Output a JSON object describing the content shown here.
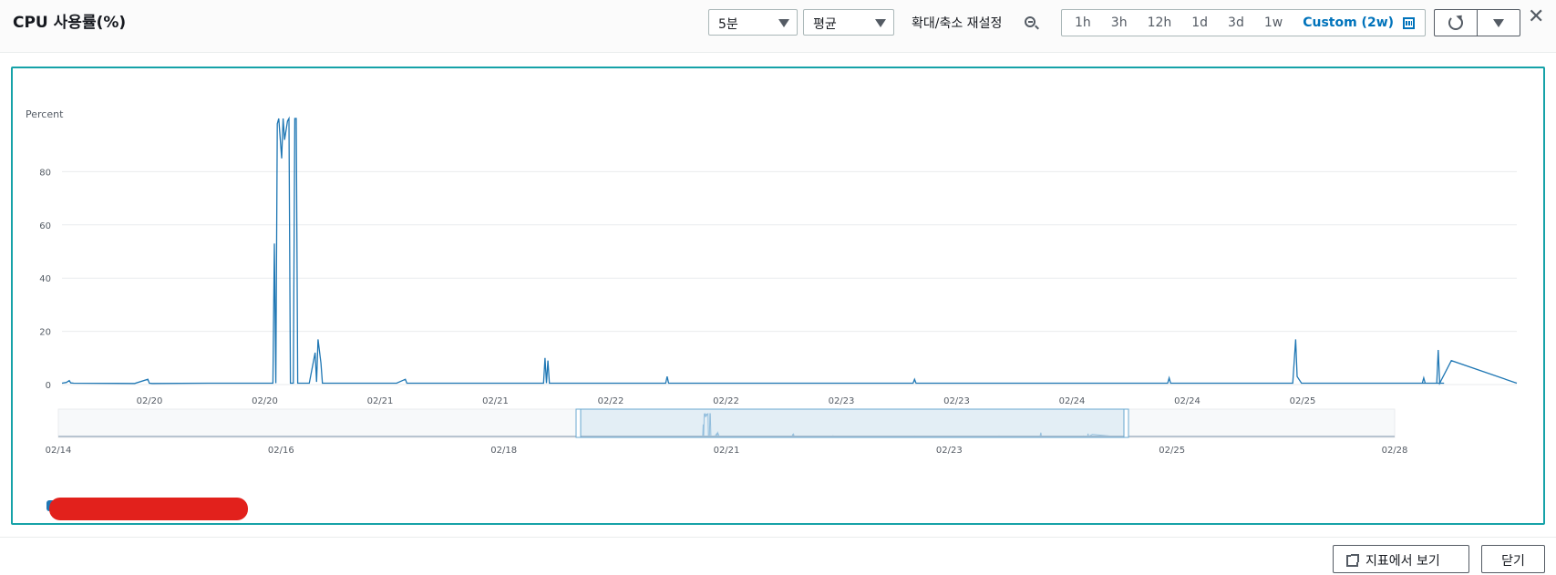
{
  "header": {
    "title": "CPU 사용률(%)",
    "period_select": "5분",
    "stat_select": "평균",
    "zoom_reset_label": "확대/축소 재설정",
    "ranges": [
      "1h",
      "3h",
      "12h",
      "1d",
      "3d",
      "1w"
    ],
    "custom_range": "Custom (2w)",
    "close_symbol": "✕"
  },
  "colors": {
    "series": "#1f77b4",
    "accent": "#0073bb",
    "panel_border": "#16a2a8",
    "redaction": "#e2211c"
  },
  "chart_data": {
    "type": "line",
    "ylabel": "Percent",
    "yticks": [
      0,
      20,
      40,
      60,
      80
    ],
    "ylim": [
      0,
      100
    ],
    "grid": true,
    "main_xticks": [
      "02/20",
      "02/20",
      "02/21",
      "02/21",
      "02/22",
      "02/22",
      "02/23",
      "02/23",
      "02/24",
      "02/24",
      "02/25"
    ],
    "main_x_range": [
      0,
      100
    ],
    "series": [
      {
        "color": "#1f77b4",
        "x": [
          0,
          0.3,
          0.5,
          0.6,
          0.8,
          5,
          5.9,
          6,
          6.2,
          10,
          14.5,
          14.6,
          14.7,
          14.8,
          14.9,
          15.1,
          15.2,
          15.3,
          15.5,
          15.6,
          15.7,
          15.9,
          16.0,
          16.1,
          16.2,
          16.4,
          16.5,
          17,
          17.4,
          17.5,
          17.6,
          17.8,
          17.9,
          18.0,
          18.3,
          19,
          23,
          23.6,
          23.7,
          24,
          30,
          33.1,
          33.2,
          33.3,
          33.4,
          33.5,
          33.6,
          40,
          41.5,
          41.6,
          41.7,
          50,
          58.5,
          58.6,
          58.7,
          70,
          76,
          76.1,
          76.2,
          84.6,
          84.8,
          84.9,
          85.2,
          95,
          93.5,
          93.6,
          93.7,
          94.5,
          94.6,
          94.7,
          95.5,
          100
        ],
        "y": [
          0.5,
          0.8,
          1.5,
          0.6,
          0.5,
          0.4,
          2,
          0.5,
          0.4,
          0.5,
          0.5,
          53,
          0.5,
          98,
          100,
          85,
          100,
          92,
          99,
          100,
          0.5,
          0.5,
          100,
          100,
          0.5,
          0.5,
          0.5,
          0.5,
          12,
          1,
          17,
          8,
          0.5,
          0.5,
          0.5,
          0.5,
          0.5,
          2,
          0.5,
          0.5,
          0.5,
          0.5,
          10,
          0.5,
          9,
          0.5,
          0.5,
          0.5,
          0.5,
          3,
          0.5,
          0.5,
          0.5,
          2,
          0.5,
          0.5,
          0.5,
          2.5,
          0.5,
          0.5,
          17,
          3,
          0.5,
          0.5,
          0.5,
          2.5,
          0.5,
          0.5,
          13,
          0.5,
          9,
          0.5
        ]
      }
    ],
    "overview": {
      "xticks": [
        "02/14",
        "02/16",
        "02/18",
        "02/21",
        "02/23",
        "02/25",
        "02/28"
      ],
      "selection_start": 38.7,
      "selection_end": 80
    }
  },
  "footer": {
    "view_in_metrics": "지표에서 보기",
    "close": "닫기"
  }
}
